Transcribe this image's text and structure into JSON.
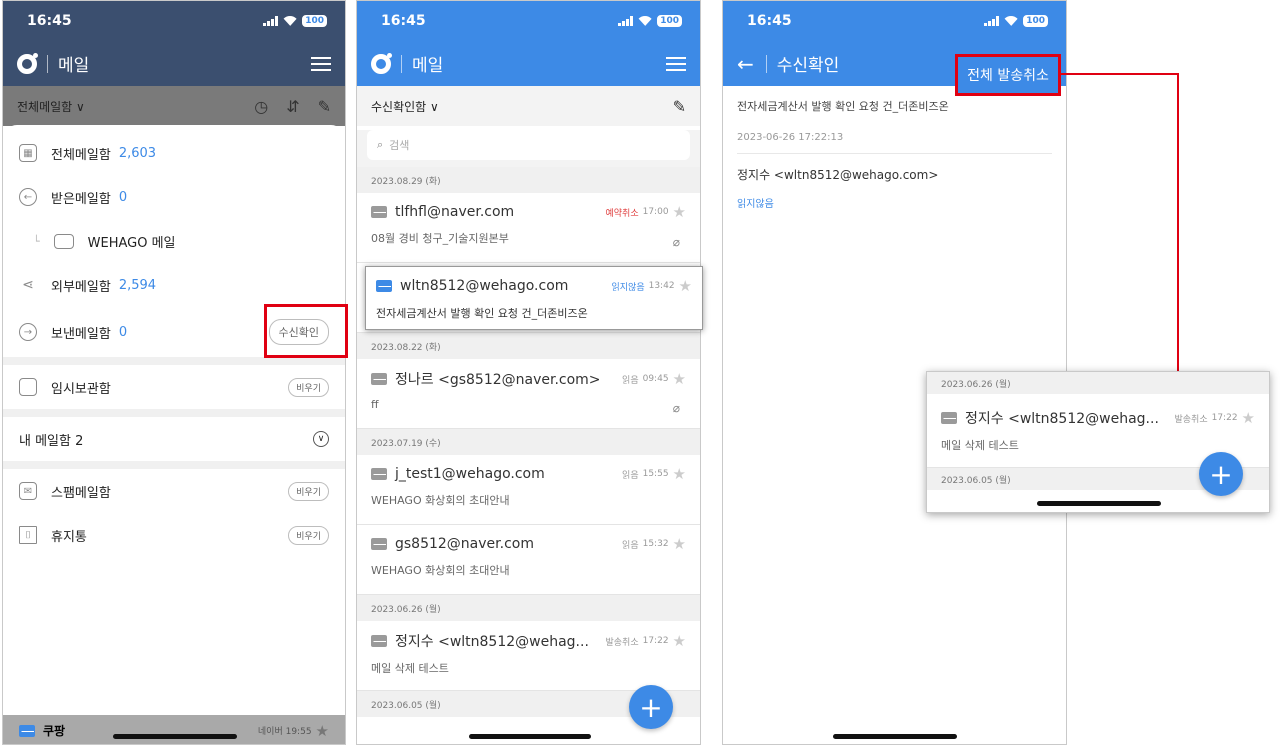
{
  "colors": {
    "accent": "#3d8ae6",
    "dim_header": "#3b4f6f",
    "callout": "#e00012"
  },
  "status": {
    "time": "16:45",
    "battery": "100"
  },
  "phone1": {
    "app_title": "메일",
    "folder_selector": "전체메일함 ∨",
    "folders": [
      {
        "label": "전체메일함",
        "count": "2,603",
        "icon": "grid-icon"
      },
      {
        "label": "받은메일함",
        "count": "0",
        "icon": "inbox-arrow-icon"
      },
      {
        "label": "WEHAGO 메일",
        "count": "",
        "icon": "folder-icon"
      },
      {
        "label": "외부메일함",
        "count": "2,594",
        "icon": "share-icon"
      },
      {
        "label": "보낸메일함",
        "count": "0",
        "icon": "sent-arrow-icon",
        "action": "수신확인"
      },
      {
        "label": "임시보관함",
        "count": "",
        "icon": "archive-icon",
        "action": "비우기"
      }
    ],
    "my_mailbox": "내 메일함 2",
    "folders2": [
      {
        "label": "스팸메일함",
        "action": "비우기",
        "icon": "spam-mail-icon"
      },
      {
        "label": "휴지통",
        "action": "비우기",
        "icon": "trash-icon"
      }
    ],
    "bottom_item": {
      "sender": "쿠팡",
      "meta": "네이버 19:55"
    }
  },
  "phone2": {
    "app_title": "메일",
    "folder_selector": "수신확인함 ∨",
    "search_placeholder": "검색",
    "groups": [
      {
        "date": "2023.08.29 (화)",
        "items": [
          {
            "sender": "tlfhfl@naver.com",
            "status": "예약취소",
            "status_color": "red",
            "time": "17:00",
            "subject": "08월 경비 청구_기술지원본부",
            "attach": true
          },
          {
            "sender": "wltn8512@wehago.com",
            "status": "읽지않음",
            "status_color": "blue",
            "time": "13:42",
            "subject": "전자세금계산서 발행 확인 요청 건_더존비즈온",
            "highlight": true
          }
        ]
      },
      {
        "date": "2023.08.22 (화)",
        "items": [
          {
            "sender": "정나르 <gs8512@naver.com>",
            "status": "읽음",
            "time": "09:45",
            "subject": "ff",
            "attach": true
          }
        ]
      },
      {
        "date": "2023.07.19 (수)",
        "items": [
          {
            "sender": "j_test1@wehago.com",
            "status": "읽음",
            "time": "15:55",
            "subject": "WEHAGO 화상회의 초대안내"
          },
          {
            "sender": "gs8512@naver.com",
            "status": "읽음",
            "time": "15:32",
            "subject": "WEHAGO 화상회의 초대안내"
          }
        ]
      },
      {
        "date": "2023.06.26 (월)",
        "items": [
          {
            "sender": "정지수 <wltn8512@wehag...",
            "status": "발송취소",
            "time": "17:22",
            "subject": "메일 삭제 테스트"
          }
        ]
      },
      {
        "date": "2023.06.05 (월)",
        "items": []
      }
    ]
  },
  "phone3": {
    "title": "수신확인",
    "cancel_all": "전체 발송취소",
    "subject": "전자세금계산서 발행 확인 요청 건_더존비즈온",
    "datetime": "2023-06-26 17:22:13",
    "recipient": "정지수 <wltn8512@wehago.com>",
    "read_status": "읽지않음"
  },
  "zoom": {
    "date1": "2023.06.26 (월)",
    "sender": "정지수 <wltn8512@wehag...",
    "status": "발송취소",
    "time": "17:22",
    "subject": "메일 삭제 테스트",
    "date2": "2023.06.05 (월)"
  }
}
